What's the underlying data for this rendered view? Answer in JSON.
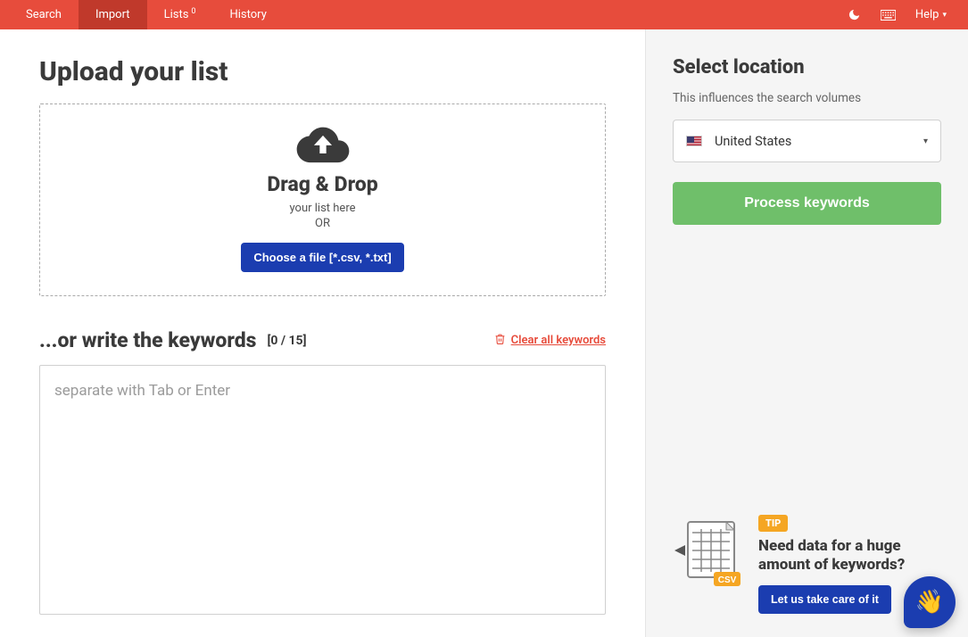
{
  "nav": {
    "items": [
      {
        "label": "Search",
        "active": false
      },
      {
        "label": "Import",
        "active": true
      },
      {
        "label": "Lists",
        "badge": "0",
        "active": false
      },
      {
        "label": "History",
        "active": false
      }
    ],
    "help_label": "Help"
  },
  "main": {
    "upload_title": "Upload your list",
    "drag_title": "Drag & Drop",
    "drag_sub": "your list here",
    "drag_or": "OR",
    "choose_label": "Choose a file [*.csv, *.txt]",
    "write_title": "...or write the keywords",
    "count_label": "[0 / 15]",
    "clear_label": "Clear all keywords",
    "kw_placeholder": "separate with Tab or Enter"
  },
  "sidebar": {
    "title": "Select location",
    "subtitle": "This influences the search volumes",
    "location_label": "United States",
    "process_label": "Process keywords",
    "tip_badge": "TIP",
    "tip_title": "Need data for a huge amount of keywords?",
    "tip_button": "Let us take care of it"
  }
}
